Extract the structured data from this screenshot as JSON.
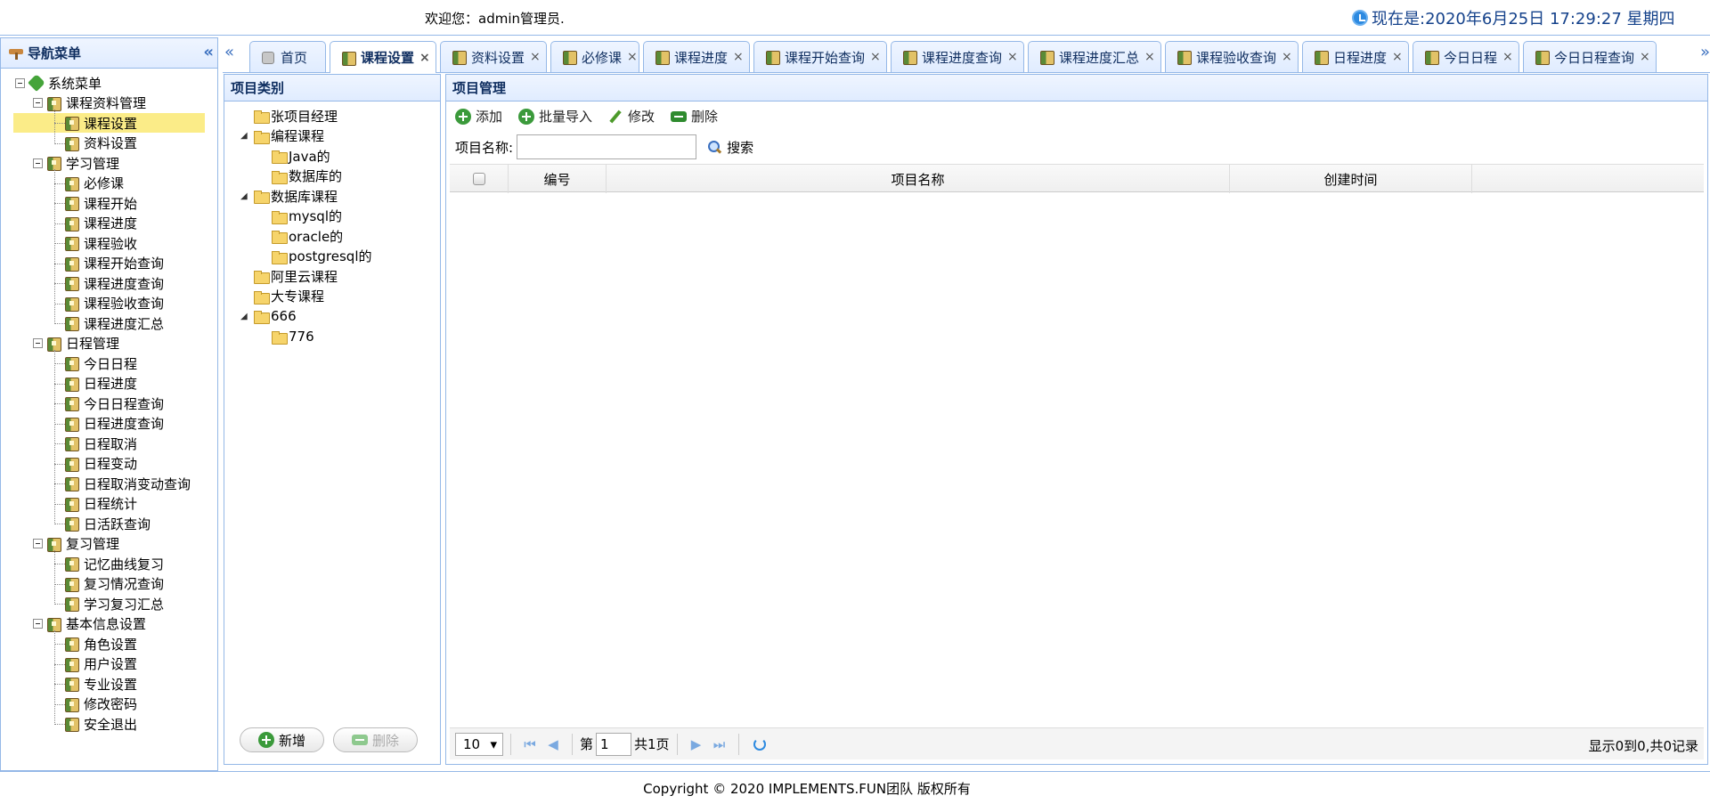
{
  "header": {
    "welcome": "欢迎您：admin管理员.",
    "clock": "现在是:2020年6月25日 17:29:27 星期四"
  },
  "nav": {
    "title": "导航菜单",
    "root": "系统菜单",
    "groups": [
      {
        "label": "课程资料管理",
        "items": [
          "课程设置",
          "资料设置"
        ]
      },
      {
        "label": "学习管理",
        "items": [
          "必修课",
          "课程开始",
          "课程进度",
          "课程验收",
          "课程开始查询",
          "课程进度查询",
          "课程验收查询",
          "课程进度汇总"
        ]
      },
      {
        "label": "日程管理",
        "items": [
          "今日日程",
          "日程进度",
          "今日日程查询",
          "日程进度查询",
          "日程取消",
          "日程变动",
          "日程取消变动查询",
          "日程统计",
          "日活跃查询"
        ]
      },
      {
        "label": "复习管理",
        "items": [
          "记忆曲线复习",
          "复习情况查询",
          "学习复习汇总"
        ]
      },
      {
        "label": "基本信息设置",
        "items": [
          "角色设置",
          "用户设置",
          "专业设置",
          "修改密码",
          "安全退出"
        ]
      }
    ],
    "selected": "课程设置"
  },
  "tabs": [
    {
      "label": "首页",
      "closable": false
    },
    {
      "label": "课程设置",
      "closable": true,
      "active": true
    },
    {
      "label": "资料设置",
      "closable": true
    },
    {
      "label": "必修课",
      "closable": true
    },
    {
      "label": "课程进度",
      "closable": true
    },
    {
      "label": "课程开始查询",
      "closable": true
    },
    {
      "label": "课程进度查询",
      "closable": true
    },
    {
      "label": "课程进度汇总",
      "closable": true
    },
    {
      "label": "课程验收查询",
      "closable": true
    },
    {
      "label": "日程进度",
      "closable": true
    },
    {
      "label": "今日日程",
      "closable": true
    },
    {
      "label": "今日日程查询",
      "closable": true
    }
  ],
  "category": {
    "title": "项目类别",
    "tree": [
      {
        "label": "张项目经理",
        "depth": 0,
        "expandable": false
      },
      {
        "label": "编程课程",
        "depth": 0,
        "expandable": true
      },
      {
        "label": "Java的",
        "depth": 1,
        "expandable": false
      },
      {
        "label": "数据库的",
        "depth": 1,
        "expandable": false
      },
      {
        "label": "数据库课程",
        "depth": 0,
        "expandable": true
      },
      {
        "label": "mysql的",
        "depth": 1,
        "expandable": false
      },
      {
        "label": "oracle的",
        "depth": 1,
        "expandable": false
      },
      {
        "label": "postgresql的",
        "depth": 1,
        "expandable": false
      },
      {
        "label": "阿里云课程",
        "depth": 0,
        "expandable": false
      },
      {
        "label": "大专课程",
        "depth": 0,
        "expandable": false
      },
      {
        "label": "666",
        "depth": 0,
        "expandable": true
      },
      {
        "label": "776",
        "depth": 1,
        "expandable": false
      }
    ],
    "add_label": "新增",
    "delete_label": "删除"
  },
  "main": {
    "title": "项目管理",
    "toolbar": {
      "add": "添加",
      "import": "批量导入",
      "edit": "修改",
      "delete": "删除"
    },
    "search": {
      "label": "项目名称:",
      "value": "",
      "button": "搜索"
    },
    "columns": [
      "编号",
      "项目名称",
      "创建时间"
    ],
    "rows": [],
    "pager": {
      "page_size": "10",
      "page_prefix": "第",
      "page": "1",
      "page_total": "共1页",
      "info": "显示0到0,共0记录"
    }
  },
  "footer": {
    "copyright": "Copyright © 2020 IMPLEMENTS.FUN团队 版权所有"
  }
}
